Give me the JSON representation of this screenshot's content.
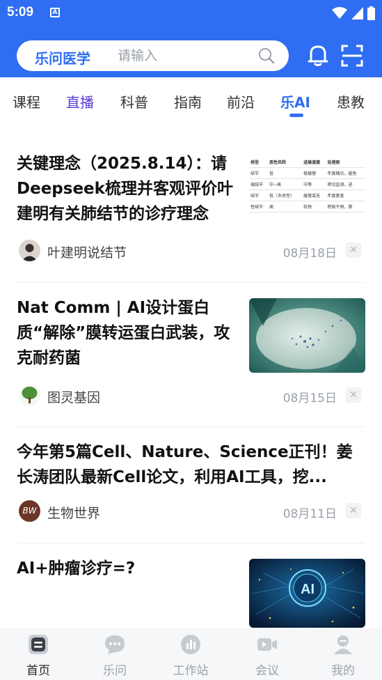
{
  "status_bar": {
    "time": "5:09",
    "notification_icon": "A"
  },
  "header": {
    "logo": "乐问医学",
    "search_placeholder": "请输入"
  },
  "tabs": [
    {
      "label": "课程"
    },
    {
      "label": "直播"
    },
    {
      "label": "科普"
    },
    {
      "label": "指南"
    },
    {
      "label": "前沿"
    },
    {
      "label": "乐AI"
    },
    {
      "label": "患教"
    }
  ],
  "articles": [
    {
      "title": "关键理念（2025.8.14）：请Deepseek梳理并客观评价叶建明有关肺结节的诊疗理念",
      "author": "叶建明说结节",
      "date": "08月18日",
      "thumbnail_table": {
        "headers": [
          "类型",
          "恶性风险",
          "进展速度",
          "处理原"
        ],
        "rows": [
          [
            "结节",
            "低",
            "极缓慢",
            "年度随访，避免"
          ],
          [
            "璃结节",
            "中~高",
            "中等",
            "密切监测，进"
          ],
          [
            "结节",
            "低（多良性）",
            "缓慢或无",
            "年度复查"
          ],
          [
            "性结节",
            "高",
            "较快",
            "积极干预，肺"
          ]
        ]
      }
    },
    {
      "title": "Nat Comm | AI设计蛋白质“解除”膜转运蛋白武装，攻克耐药菌",
      "author": "图灵基因",
      "date": "08月15日"
    },
    {
      "title": "今年第5篇Cell、Nature、Science正刊！姜长涛团队最新Cell论文，利用AI工具，挖...",
      "author": "生物世界",
      "date": "08月11日",
      "avatar_text": "BW"
    },
    {
      "title": "AI+肿瘤诊疗=?",
      "thumbnail_text": "AI"
    }
  ],
  "bottom_nav": [
    {
      "label": "首页",
      "icon": "home-icon"
    },
    {
      "label": "乐问",
      "icon": "chat-icon"
    },
    {
      "label": "工作站",
      "icon": "workstation-icon"
    },
    {
      "label": "会议",
      "icon": "video-icon"
    },
    {
      "label": "我的",
      "icon": "profile-icon"
    }
  ],
  "colors": {
    "brand": "#2f6df2",
    "live": "#5b3bd6"
  }
}
